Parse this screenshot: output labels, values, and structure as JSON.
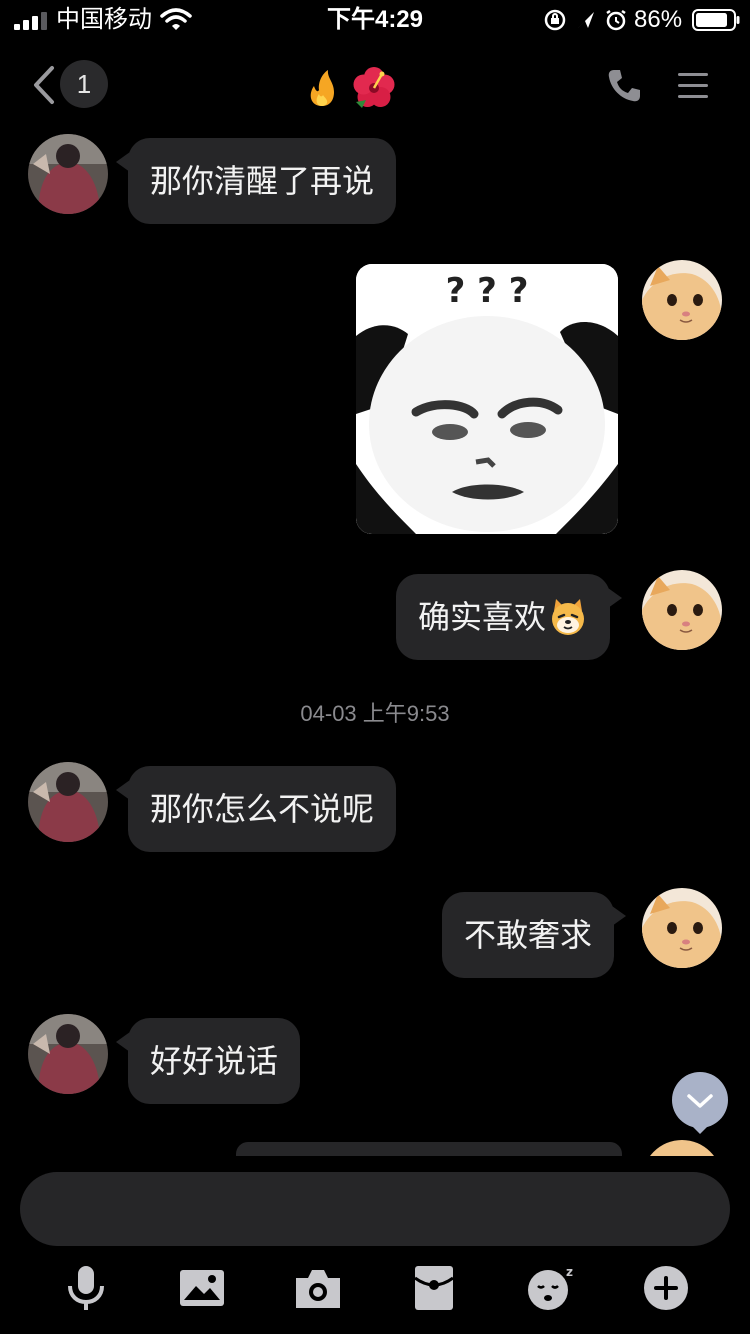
{
  "status_bar": {
    "carrier": "中国移动",
    "time": "下午4:29",
    "battery": "86%"
  },
  "nav": {
    "unread_count": "1",
    "title_icons": [
      "fire-icon",
      "hibiscus-icon"
    ]
  },
  "messages": [
    {
      "side": "left",
      "text": "那你清醒了再说"
    },
    {
      "side": "right",
      "type": "sticker",
      "sticker_text": "? ? ?"
    },
    {
      "side": "right",
      "text": "确实喜欢",
      "emoji": "dog-face-emoji"
    },
    {
      "side": "left",
      "text": "那你怎么不说呢"
    },
    {
      "side": "right",
      "text": "不敢奢求"
    },
    {
      "side": "left",
      "text": "好好说话"
    }
  ],
  "timestamp": "04-03 上午9:53",
  "toolbar": [
    "microphone-icon",
    "image-icon",
    "camera-icon",
    "red-packet-icon",
    "sticker-icon",
    "plus-icon"
  ],
  "colors": {
    "bubble": "#262628",
    "background": "#000000",
    "scroll_button": "#a9b2c8"
  }
}
